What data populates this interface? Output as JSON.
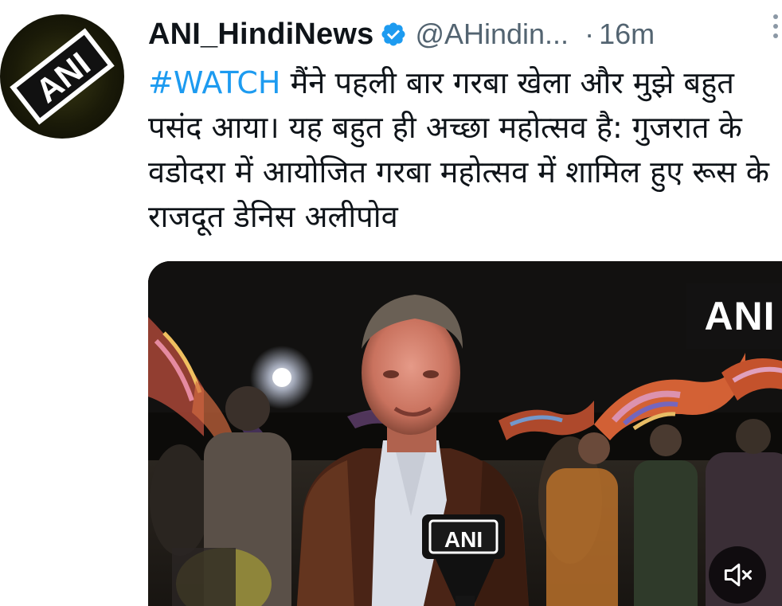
{
  "author": {
    "display_name": "ANI_HindiNews",
    "handle": "@AHindin...",
    "separator": "·",
    "time_ago": "16m",
    "verified_color": "#1d9bf0",
    "avatar_logo_text": "ANI"
  },
  "tweet": {
    "hashtag": "#WATCH",
    "body": " मैंने पहली बार गरबा खेला और मुझे बहुत पसंद आया। यह बहुत ही अच्छा महोत्सव है: गुजरात के वडोदरा में आयोजित गरबा महोत्सव में शामिल हुए रूस के राजदूत डेनिस अलीपोव",
    "hashtag_color": "#1d9bf0"
  },
  "media": {
    "watermark_text": "ANI",
    "mic_flag_text": "ANI",
    "mute_icon": "speaker-muted-icon"
  },
  "icons": {
    "verified": "verified-badge-icon",
    "more": "more-vertical-icon"
  }
}
